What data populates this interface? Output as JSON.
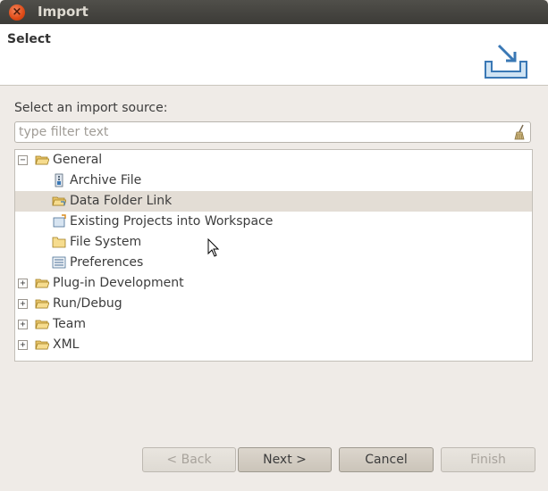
{
  "window": {
    "title": "Import",
    "close_symbol": "×"
  },
  "header": {
    "title": "Select"
  },
  "source_label": "Select an import source:",
  "filter": {
    "placeholder": "type filter text",
    "value": ""
  },
  "tree": {
    "rows": [
      {
        "label": "General",
        "expander": "−",
        "level": 0,
        "icon": "folder-open-icon",
        "selected": false
      },
      {
        "label": "Archive File",
        "expander": "",
        "level": 1,
        "icon": "archive-file-icon",
        "selected": false
      },
      {
        "label": "Data Folder Link",
        "expander": "",
        "level": 1,
        "icon": "folder-link-icon",
        "selected": true
      },
      {
        "label": "Existing Projects into Workspace",
        "expander": "",
        "level": 1,
        "icon": "projects-icon",
        "selected": false
      },
      {
        "label": "File System",
        "expander": "",
        "level": 1,
        "icon": "folder-icon",
        "selected": false
      },
      {
        "label": "Preferences",
        "expander": "",
        "level": 1,
        "icon": "preferences-icon",
        "selected": false
      },
      {
        "label": "Plug-in Development",
        "expander": "+",
        "level": 0,
        "icon": "folder-open-icon",
        "selected": false
      },
      {
        "label": "Run/Debug",
        "expander": "+",
        "level": 0,
        "icon": "folder-open-icon",
        "selected": false
      },
      {
        "label": "Team",
        "expander": "+",
        "level": 0,
        "icon": "folder-open-icon",
        "selected": false
      },
      {
        "label": "XML",
        "expander": "+",
        "level": 0,
        "icon": "folder-open-icon",
        "selected": false
      }
    ]
  },
  "buttons": {
    "back": "< Back",
    "next": "Next >",
    "cancel": "Cancel",
    "finish": "Finish"
  },
  "colors": {
    "selection": "#e3ddd5",
    "titlebar": "#3c3b37",
    "close": "#df4a16"
  }
}
